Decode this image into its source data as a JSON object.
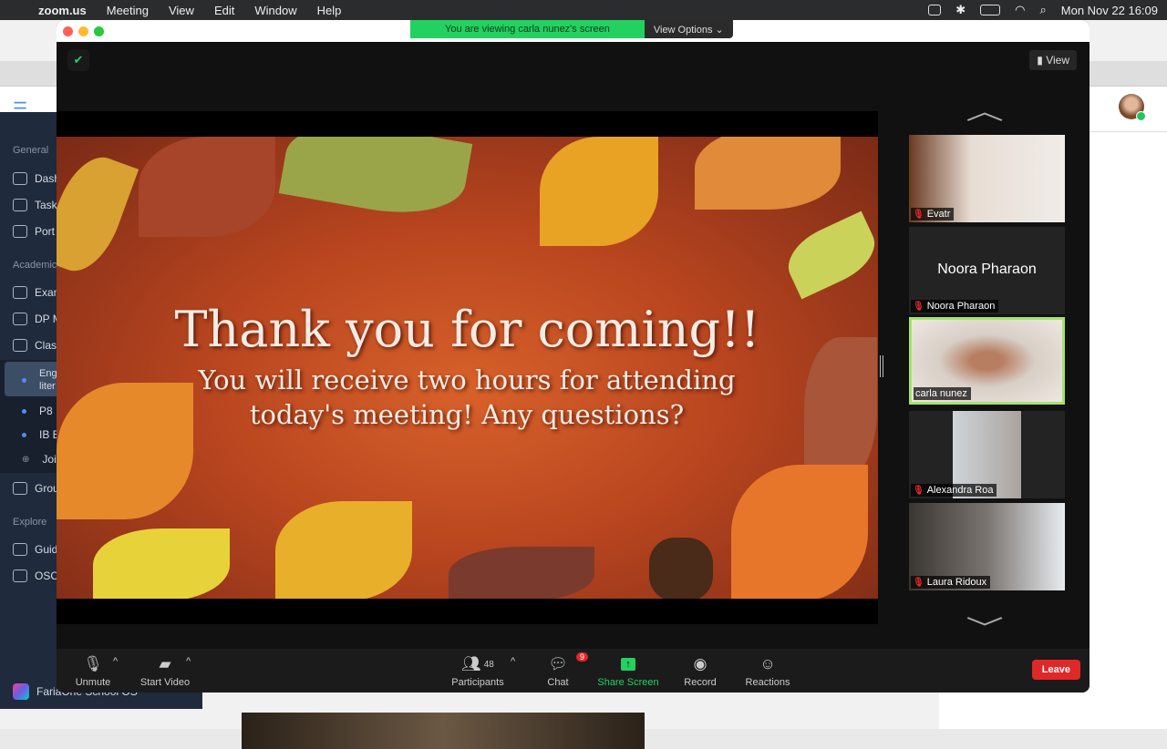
{
  "menubar": {
    "apple": "",
    "app": "zoom.us",
    "items": [
      "Meeting",
      "View",
      "Edit",
      "Window",
      "Help"
    ],
    "datetime": "Mon Nov 22  16:09"
  },
  "sidebar": {
    "general": "General",
    "items": [
      "Dash",
      "Task",
      "Port"
    ],
    "academic": "Academic",
    "acad_items": [
      "Exan",
      "DP M",
      "Clas"
    ],
    "classes": [
      "Eng\nliter",
      "P8",
      "IB E",
      "Join"
    ],
    "groups": "Grou",
    "explore": "Explore",
    "explore_items": [
      "Guid",
      "OSC"
    ],
    "brand": "FariaOne School OS"
  },
  "zoom": {
    "banner": "You are viewing carla nunez's screen",
    "view_options": "View Options ⌄",
    "view_button": "View",
    "slide": {
      "title": "Thank you for coming!!",
      "body": "You will receive two hours for attending today's meeting! Any questions?"
    },
    "participants": [
      {
        "name": "Evatr",
        "muted": true
      },
      {
        "name": "Noora Pharaon",
        "muted": true,
        "video_off": true
      },
      {
        "name": "carla nunez",
        "active": true
      },
      {
        "name": "Alexandra Roa",
        "muted": true
      },
      {
        "name": "Laura Ridoux",
        "muted": true
      }
    ],
    "toolbar": {
      "unmute": "Unmute",
      "start_video": "Start Video",
      "participants": "Participants",
      "participant_count": "48",
      "chat": "Chat",
      "chat_badge": "9",
      "share": "Share Screen",
      "record": "Record",
      "reactions": "Reactions",
      "leave": "Leave"
    },
    "colors": {
      "share": "#23d160",
      "leave": "#e02828",
      "active_speaker": "#a6e36b"
    }
  }
}
